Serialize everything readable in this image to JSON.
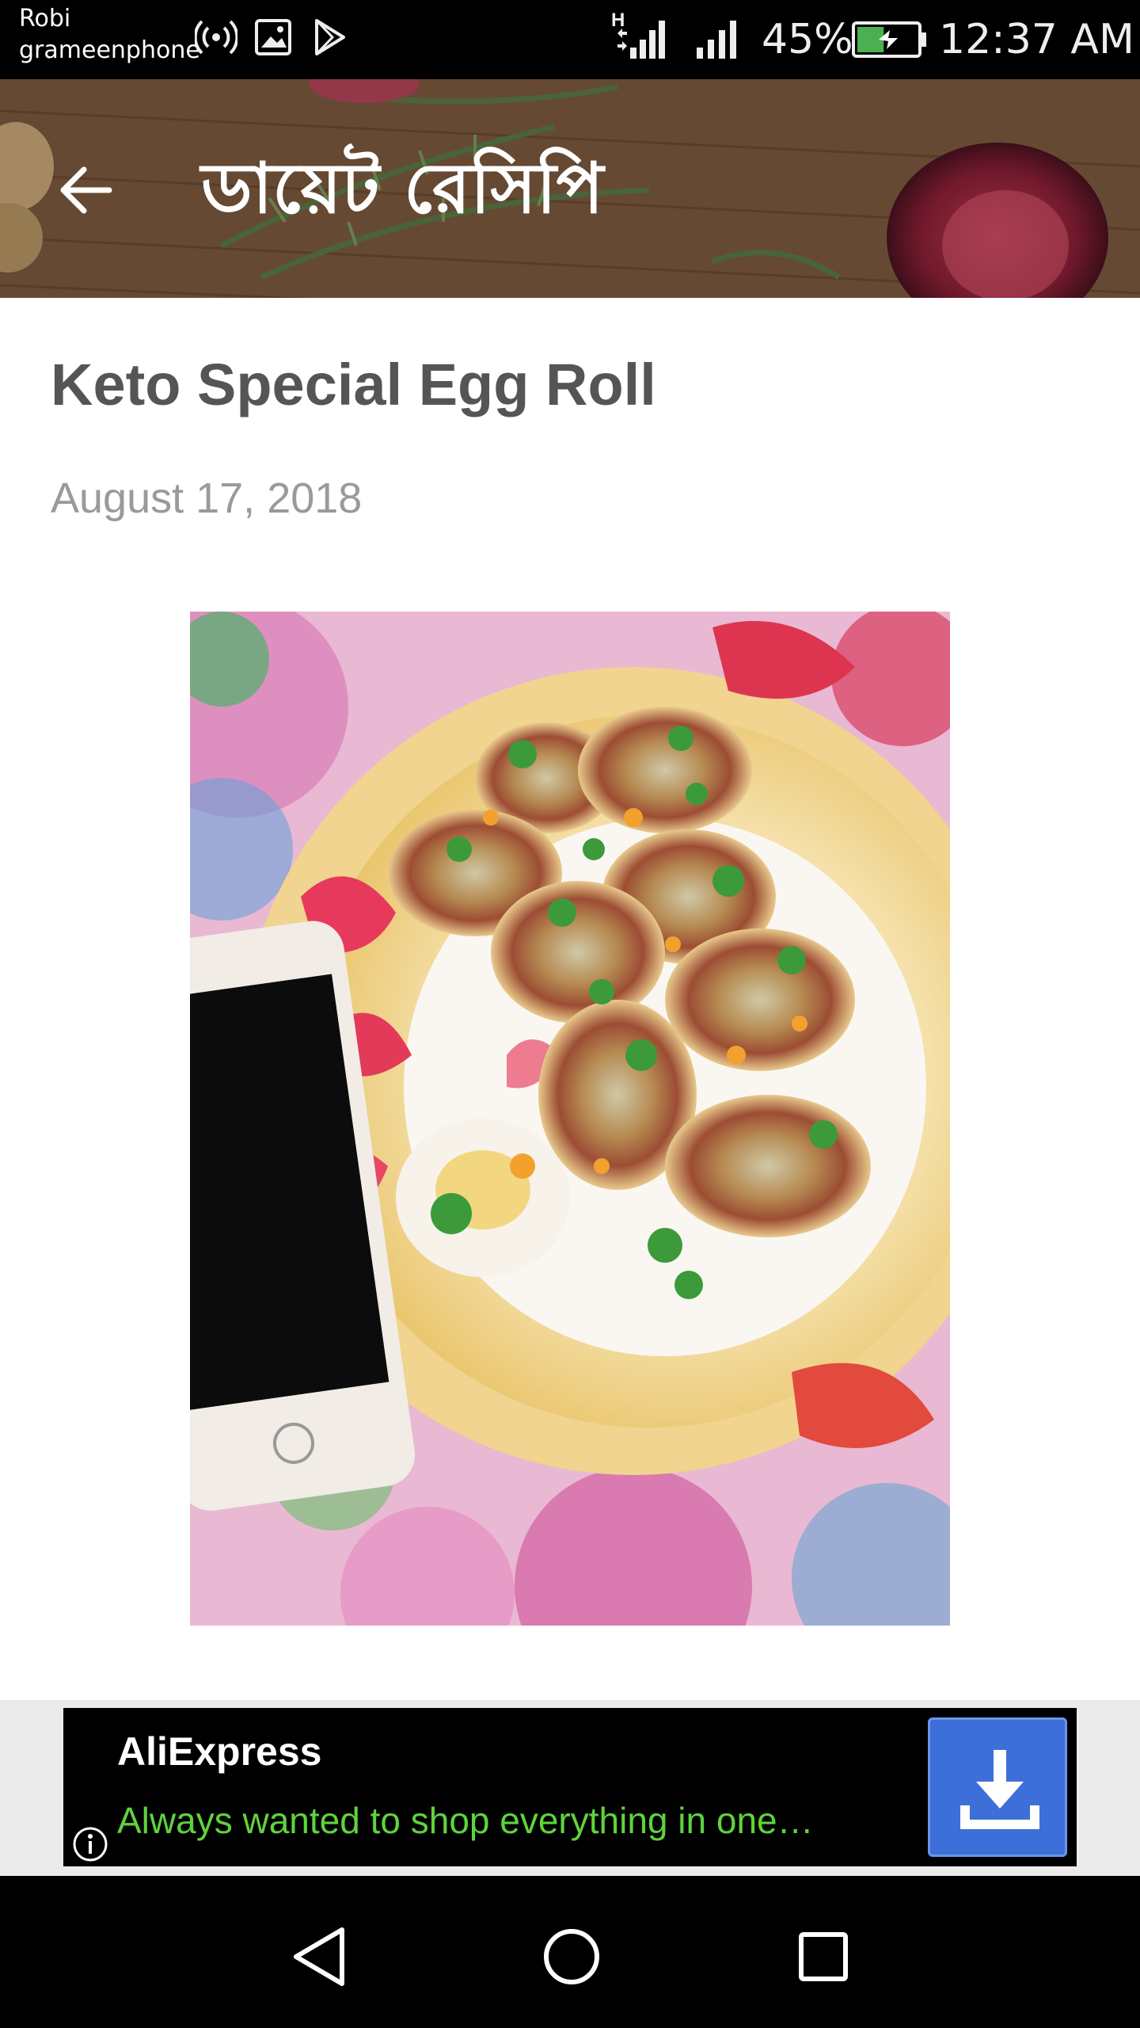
{
  "status_bar": {
    "carrier_primary": "Robi",
    "carrier_secondary": "grameenphone",
    "network_type": "H",
    "battery_percent": "45%",
    "time": "12:37 AM",
    "battery_level": 0.45,
    "icons": [
      "hotspot-icon",
      "image-icon",
      "play-store-icon",
      "signal-icon",
      "signal-icon",
      "battery-icon"
    ]
  },
  "toolbar": {
    "title": "ডায়েট রেসিপি",
    "back_icon": "arrow-back-icon"
  },
  "article": {
    "title": "Keto Special Egg Roll",
    "date": "August 17, 2018",
    "photo": "egg-roll-photo"
  },
  "ad": {
    "advertiser": "AliExpress",
    "text": "Always wanted to shop everything in one…",
    "info_icon": "info-icon",
    "download_icon": "download-icon"
  },
  "nav_bar": {
    "buttons": [
      "back-triangle-icon",
      "home-circle-icon",
      "recents-square-icon"
    ]
  },
  "colors": {
    "ad_text": "#5fd33d",
    "download_button": "#3d6fd9",
    "title_text": "#555555",
    "date_text": "#9a9a9a"
  }
}
